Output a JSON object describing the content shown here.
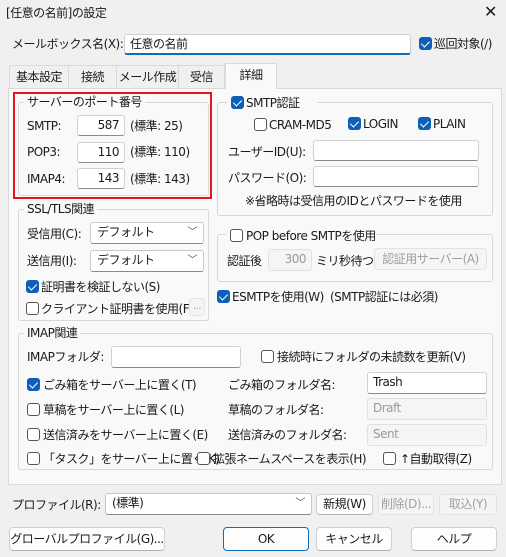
{
  "window": {
    "title": "[任意の名前]の設定",
    "close_icon": "close-icon"
  },
  "mailbox": {
    "label": "メールボックス名(X):",
    "value": "任意の名前",
    "patrol_label": "巡回対象(/)",
    "patrol_checked": true
  },
  "tabs": [
    {
      "label": "基本設定"
    },
    {
      "label": "接続"
    },
    {
      "label": "メール作成"
    },
    {
      "label": "受信"
    },
    {
      "label": "詳細",
      "selected": true
    }
  ],
  "ports": {
    "title": "サーバーのポート番号",
    "rows": [
      {
        "label": "SMTP:",
        "value": "587",
        "std": "(標準: 25)"
      },
      {
        "label": "POP3:",
        "value": "110",
        "std": "(標準: 110)"
      },
      {
        "label": "IMAP4:",
        "value": "143",
        "std": "(標準: 143)"
      }
    ],
    "highlight_color": "#e8141c"
  },
  "smtp_auth": {
    "label": "SMTP認証",
    "checked": true,
    "cram": {
      "label": "CRAM-MD5",
      "checked": false
    },
    "login": {
      "label": "LOGIN",
      "checked": true
    },
    "plain": {
      "label": "PLAIN",
      "checked": true
    },
    "user_label": "ユーザーID(U):",
    "user_value": "",
    "pass_label": "パスワード(O):",
    "pass_value": "",
    "note": "※省略時は受信用のIDとパスワードを使用"
  },
  "ssl": {
    "title": "SSL/TLS関連",
    "recv_label": "受信用(C):",
    "recv_value": "デフォルト",
    "send_label": "送信用(I):",
    "send_value": "デフォルト",
    "noverify": {
      "label": "証明書を検証しない(S)",
      "checked": true
    },
    "client": {
      "label": "クライアント証明書を使用(F)",
      "checked": false
    },
    "browse": "..."
  },
  "pop_before": {
    "label": "POP before SMTPを使用",
    "checked": false,
    "after_label": "認証後",
    "wait_value": "300",
    "wait_unit": "ミリ秒待つ",
    "server_button": "認証用サーバー(A)"
  },
  "esmtp": {
    "label": "ESMTPを使用(W)",
    "checked": true,
    "note": "(SMTP認証には必須)"
  },
  "imap": {
    "title": "IMAP関連",
    "folder_label": "IMAPフォルダ:",
    "folder_value": "",
    "update_unread": {
      "label": "接続時にフォルダの未読数を更新(V)",
      "checked": false
    },
    "rows": [
      {
        "label": "ごみ箱をサーバー上に置く(T)",
        "checked": true,
        "name_label": "ごみ箱のフォルダ名:",
        "name_value": "Trash",
        "enabled": true
      },
      {
        "label": "草稿をサーバー上に置く(L)",
        "checked": false,
        "name_label": "草稿のフォルダ名:",
        "name_value": "Draft",
        "enabled": false
      },
      {
        "label": "送信済みをサーバー上に置く(E)",
        "checked": false,
        "name_label": "送信済みのフォルダ名:",
        "name_value": "Sent",
        "enabled": false
      }
    ],
    "task": {
      "label": "「タスク」をサーバー上に置く(K)",
      "checked": false
    },
    "namespace": {
      "label": "拡張ネームスペースを表示(H)",
      "checked": false
    },
    "auto": {
      "label": "↑自動取得(Z)",
      "checked": false
    }
  },
  "profile": {
    "label": "プロファイル(R):",
    "value": "(標準)",
    "new": "新規(W)",
    "delete": "削除(D)...",
    "import": "取込(Y)"
  },
  "buttons": {
    "global": "グローバルプロファイル(G)...",
    "ok": "OK",
    "cancel": "キャンセル",
    "help": "ヘルプ"
  }
}
